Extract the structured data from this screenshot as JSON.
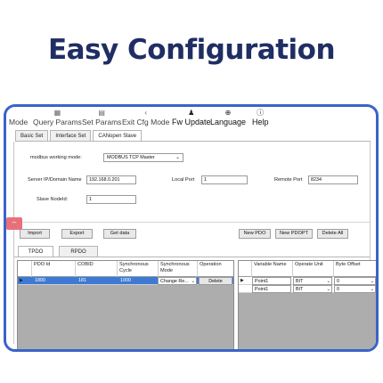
{
  "headline": "Easy Configuration",
  "menu": {
    "mode": "Mode",
    "query_params": "Query Params",
    "set_params": "Set Params",
    "exit_cfg_mode": "Exit Cfg Mode",
    "fw_update": "Fw Update",
    "language": "Language",
    "help": "Help",
    "icon_glyphs": {
      "query": "▦",
      "set": "▤",
      "exit": "‹",
      "fw": "♟",
      "language": "⊕",
      "help": "ⓘ"
    }
  },
  "tabs": [
    "Basic Set",
    "Interface Set",
    "CANopen Slave"
  ],
  "form": {
    "working_mode_label": "modbus working mode:",
    "working_mode_value": "MODBUS TCP Master",
    "server_label": "Server IP/Domain Name",
    "server_value": "192.168.0.201",
    "local_port_label": "Local Port",
    "local_port_value": "1",
    "remote_port_label": "Remote Port",
    "remote_port_value": "8234",
    "slave_node_label": "Slave NodeId:",
    "slave_node_value": "1"
  },
  "buttons": {
    "import": "Import",
    "export": "Export",
    "get_data": "Get data",
    "new_pdo": "New PDO",
    "new_pdopt": "New PDOPT",
    "delete_all": "Delete All"
  },
  "handle_glyph": "–",
  "pdo_tabs": [
    "TPDO",
    "RPDO"
  ],
  "pdo_table": {
    "headers": [
      "PDO Id",
      "COBID",
      "Synchronous Cycle",
      "Synchronous Mode",
      "Operation"
    ],
    "rows": [
      {
        "marker": "▶",
        "pdo_id": "1800",
        "cobid": "181",
        "cycle": "1000",
        "mode": "Change Re...",
        "operation": "Delete"
      }
    ]
  },
  "var_table": {
    "headers": [
      "Variable Name",
      "Operate Unit",
      "Byte Offset"
    ],
    "rows": [
      {
        "marker": "▶",
        "name": "Point1",
        "unit": "BIT",
        "offset": "0"
      },
      {
        "marker": "",
        "name": "Point1",
        "unit": "BIT",
        "offset": "0"
      }
    ]
  },
  "colors": {
    "headline": "#1f2e63",
    "window_border": "#3a63c9",
    "selected_row": "#3d7ad6",
    "handle": "#e8707a"
  }
}
